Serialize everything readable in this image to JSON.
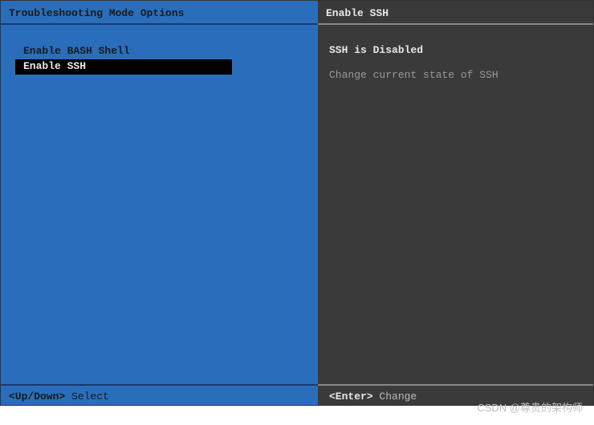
{
  "left": {
    "title": "Troubleshooting Mode Options",
    "items": [
      {
        "label": "Enable BASH Shell",
        "selected": false
      },
      {
        "label": "Enable SSH",
        "selected": true
      }
    ],
    "footer": {
      "keys": "<Up/Down>",
      "action": "Select"
    }
  },
  "right": {
    "title": "Enable SSH",
    "status": "SSH is Disabled",
    "help": "Change current state of SSH",
    "footer": {
      "keys": "<Enter>",
      "action": "Change"
    }
  },
  "watermark": "CSDN @尊贵的架构师"
}
